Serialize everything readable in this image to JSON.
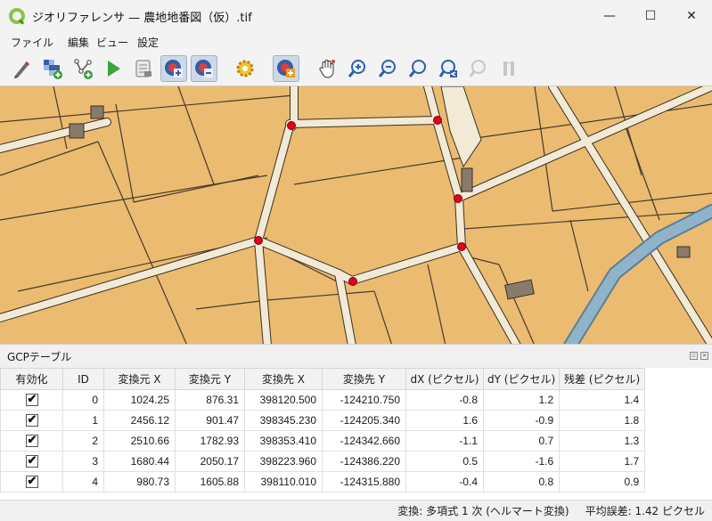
{
  "window": {
    "title": "ジオリファレンサ — 農地地番図（仮）.tif",
    "controls": {
      "minimize": "—",
      "maximize": "☐",
      "close": "✕"
    }
  },
  "menu": [
    "ファイル",
    "編集",
    "ビュー",
    "設定"
  ],
  "toolbar": {
    "icons": [
      "open-raster-icon",
      "start-georeferencing-icon",
      "generate-gdal-script-icon",
      "load-gcp-icon",
      "save-gcp-icon",
      "add-point-icon",
      "delete-point-icon",
      "move-gcp-icon",
      "transformation-settings-icon",
      "link-georeferencer-icon",
      "pan-icon",
      "zoom-in-icon",
      "zoom-out-icon",
      "zoom-to-layer-icon",
      "zoom-last-icon",
      "zoom-next-icon",
      "full-histogram-icon"
    ]
  },
  "gcp": {
    "title": "GCPテーブル",
    "columns": [
      "有効化",
      "ID",
      "変換元 X",
      "変換元 Y",
      "変換先 X",
      "変換先 Y",
      "dX (ピクセル)",
      "dY (ピクセル)",
      "残差 (ピクセル)"
    ],
    "rows": [
      {
        "enabled": true,
        "id": "0",
        "src_x": "1024.25",
        "src_y": "876.31",
        "dst_x": "398120.500",
        "dst_y": "-124210.750",
        "dx": "-0.8",
        "dy": "1.2",
        "res": "1.4"
      },
      {
        "enabled": true,
        "id": "1",
        "src_x": "2456.12",
        "src_y": "901.47",
        "dst_x": "398345.230",
        "dst_y": "-124205.340",
        "dx": "1.6",
        "dy": "-0.9",
        "res": "1.8"
      },
      {
        "enabled": true,
        "id": "2",
        "src_x": "2510.66",
        "src_y": "1782.93",
        "dst_x": "398353.410",
        "dst_y": "-124342.660",
        "dx": "-1.1",
        "dy": "0.7",
        "res": "1.3"
      },
      {
        "enabled": true,
        "id": "3",
        "src_x": "1680.44",
        "src_y": "2050.17",
        "dst_x": "398223.960",
        "dst_y": "-124386.220",
        "dx": "0.5",
        "dy": "-1.6",
        "res": "1.7"
      },
      {
        "enabled": true,
        "id": "4",
        "src_x": "980.73",
        "src_y": "1605.88",
        "dst_x": "398110.010",
        "dst_y": "-124315.880",
        "dx": "-0.4",
        "dy": "0.8",
        "res": "0.9"
      }
    ]
  },
  "status": {
    "transform": "変換: 多項式 1 次 (ヘルマート変換)",
    "mean_error": "平均誤差: 1.42 ピクセル"
  },
  "colors": {
    "parcel": "#e8b76a",
    "road": "#f2ead6",
    "water": "#8fb3c9",
    "gcp": "#e0001a"
  }
}
